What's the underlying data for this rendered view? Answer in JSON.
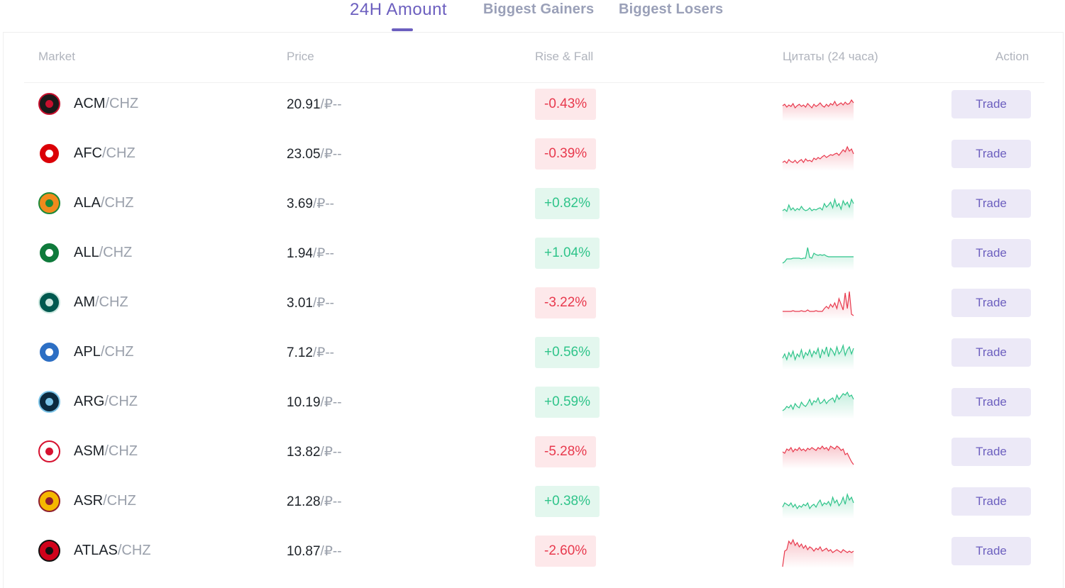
{
  "tabs": [
    {
      "label": "24H Amount",
      "active": true
    },
    {
      "label": "Biggest Gainers",
      "active": false
    },
    {
      "label": "Biggest Losers",
      "active": false
    }
  ],
  "table": {
    "headers": {
      "market": "Market",
      "price": "Price",
      "change": "Rise & Fall",
      "quotes": "Цитаты (24 часа)",
      "action": "Action"
    },
    "rows": [
      {
        "base": "ACM",
        "quote": "/CHZ",
        "price": "20.91",
        "fiat": "/₽--",
        "change": "-0.43%",
        "direction": "down",
        "trade": "Trade",
        "logo_icon": "acm-logo-icon",
        "logo_color": "#1a1a1a",
        "logo_accent": "#c8102e"
      },
      {
        "base": "AFC",
        "quote": "/CHZ",
        "price": "23.05",
        "fiat": "/₽--",
        "change": "-0.39%",
        "direction": "down",
        "trade": "Trade",
        "logo_icon": "afc-logo-icon",
        "logo_color": "#db0007",
        "logo_accent": "#ffffff"
      },
      {
        "base": "ALA",
        "quote": "/CHZ",
        "price": "3.69",
        "fiat": "/₽--",
        "change": "+0.82%",
        "direction": "up",
        "trade": "Trade",
        "logo_icon": "ala-logo-icon",
        "logo_color": "#f28a1c",
        "logo_accent": "#1b8a3a"
      },
      {
        "base": "ALL",
        "quote": "/CHZ",
        "price": "1.94",
        "fiat": "/₽--",
        "change": "+1.04%",
        "direction": "up",
        "trade": "Trade",
        "logo_icon": "all-logo-icon",
        "logo_color": "#0f7a3b",
        "logo_accent": "#ffffff"
      },
      {
        "base": "AM",
        "quote": "/CHZ",
        "price": "3.01",
        "fiat": "/₽--",
        "change": "-3.22%",
        "direction": "down",
        "trade": "Trade",
        "logo_icon": "am-logo-icon",
        "logo_color": "#00594f",
        "logo_accent": "#cde8e0"
      },
      {
        "base": "APL",
        "quote": "/CHZ",
        "price": "7.12",
        "fiat": "/₽--",
        "change": "+0.56%",
        "direction": "up",
        "trade": "Trade",
        "logo_icon": "apl-logo-icon",
        "logo_color": "#2d6fc4",
        "logo_accent": "#ffffff"
      },
      {
        "base": "ARG",
        "quote": "/CHZ",
        "price": "10.19",
        "fiat": "/₽--",
        "change": "+0.59%",
        "direction": "up",
        "trade": "Trade",
        "logo_icon": "arg-logo-icon",
        "logo_color": "#0b2a3f",
        "logo_accent": "#7cc4e8"
      },
      {
        "base": "ASM",
        "quote": "/CHZ",
        "price": "13.82",
        "fiat": "/₽--",
        "change": "-5.28%",
        "direction": "down",
        "trade": "Trade",
        "logo_icon": "asm-logo-icon",
        "logo_color": "#ffffff",
        "logo_accent": "#d6112f"
      },
      {
        "base": "ASR",
        "quote": "/CHZ",
        "price": "21.28",
        "fiat": "/₽--",
        "change": "+0.38%",
        "direction": "up",
        "trade": "Trade",
        "logo_icon": "asr-logo-icon",
        "logo_color": "#f5b800",
        "logo_accent": "#8e1f2f"
      },
      {
        "base": "ATLAS",
        "quote": "/CHZ",
        "price": "10.87",
        "fiat": "/₽--",
        "change": "-2.60%",
        "direction": "down",
        "trade": "Trade",
        "logo_icon": "atlas-logo-icon",
        "logo_color": "#d0021b",
        "logo_accent": "#111111"
      }
    ]
  },
  "colors": {
    "accent": "#6c5fbf",
    "down": "#e8394d",
    "up": "#2fc48a"
  }
}
